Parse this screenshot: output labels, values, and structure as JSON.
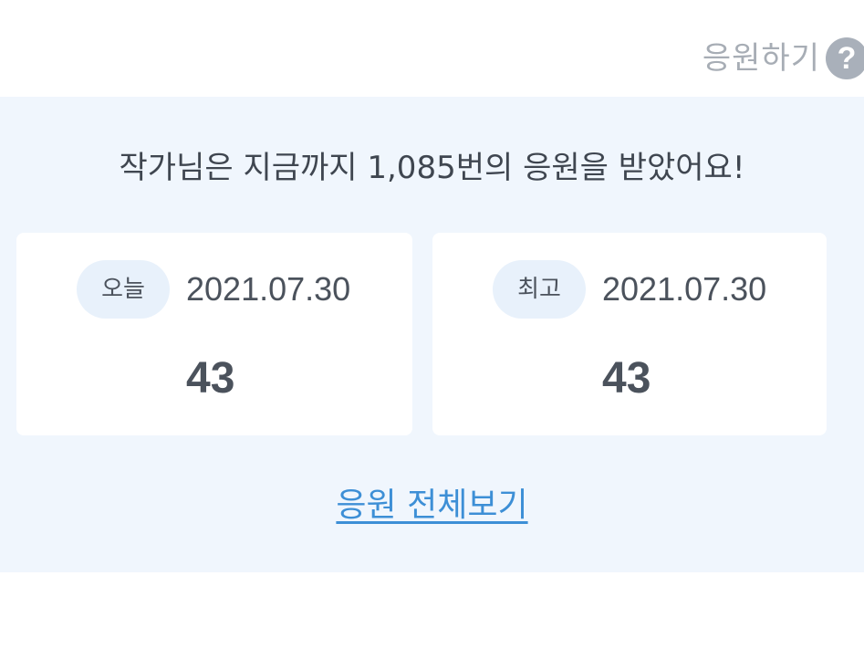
{
  "header": {
    "support_label": "응원하기",
    "help_icon_glyph": "?"
  },
  "summary": {
    "message": "작가님은 지금까지 1,085번의 응원을 받았어요!"
  },
  "cards": {
    "today": {
      "label": "오늘",
      "date": "2021.07.30",
      "count": "43"
    },
    "best": {
      "label": "최고",
      "date": "2021.07.30",
      "count": "43"
    }
  },
  "footer": {
    "view_all_label": "응원 전체보기"
  },
  "colors": {
    "panel_bg": "#f0f6fd",
    "link": "#3d8fd6",
    "muted_text": "#a7adb5",
    "pill_bg": "#e8f1fb"
  }
}
